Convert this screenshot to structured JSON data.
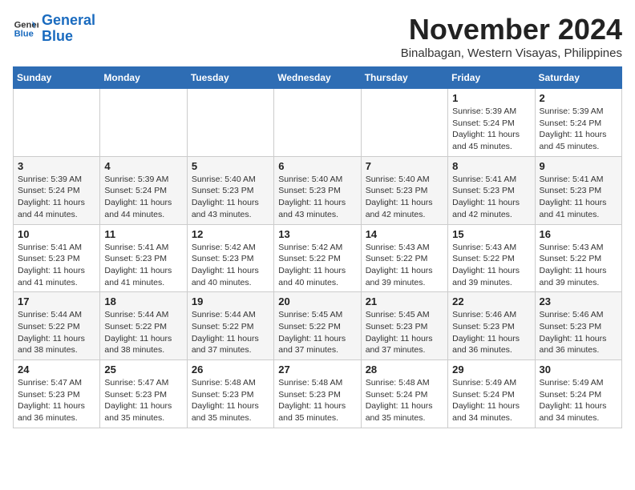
{
  "logo": {
    "text_general": "General",
    "text_blue": "Blue"
  },
  "header": {
    "month_year": "November 2024",
    "location": "Binalbagan, Western Visayas, Philippines"
  },
  "days_of_week": [
    "Sunday",
    "Monday",
    "Tuesday",
    "Wednesday",
    "Thursday",
    "Friday",
    "Saturday"
  ],
  "weeks": [
    [
      {
        "day": "",
        "info": ""
      },
      {
        "day": "",
        "info": ""
      },
      {
        "day": "",
        "info": ""
      },
      {
        "day": "",
        "info": ""
      },
      {
        "day": "",
        "info": ""
      },
      {
        "day": "1",
        "info": "Sunrise: 5:39 AM\nSunset: 5:24 PM\nDaylight: 11 hours and 45 minutes."
      },
      {
        "day": "2",
        "info": "Sunrise: 5:39 AM\nSunset: 5:24 PM\nDaylight: 11 hours and 45 minutes."
      }
    ],
    [
      {
        "day": "3",
        "info": "Sunrise: 5:39 AM\nSunset: 5:24 PM\nDaylight: 11 hours and 44 minutes."
      },
      {
        "day": "4",
        "info": "Sunrise: 5:39 AM\nSunset: 5:24 PM\nDaylight: 11 hours and 44 minutes."
      },
      {
        "day": "5",
        "info": "Sunrise: 5:40 AM\nSunset: 5:23 PM\nDaylight: 11 hours and 43 minutes."
      },
      {
        "day": "6",
        "info": "Sunrise: 5:40 AM\nSunset: 5:23 PM\nDaylight: 11 hours and 43 minutes."
      },
      {
        "day": "7",
        "info": "Sunrise: 5:40 AM\nSunset: 5:23 PM\nDaylight: 11 hours and 42 minutes."
      },
      {
        "day": "8",
        "info": "Sunrise: 5:41 AM\nSunset: 5:23 PM\nDaylight: 11 hours and 42 minutes."
      },
      {
        "day": "9",
        "info": "Sunrise: 5:41 AM\nSunset: 5:23 PM\nDaylight: 11 hours and 41 minutes."
      }
    ],
    [
      {
        "day": "10",
        "info": "Sunrise: 5:41 AM\nSunset: 5:23 PM\nDaylight: 11 hours and 41 minutes."
      },
      {
        "day": "11",
        "info": "Sunrise: 5:41 AM\nSunset: 5:23 PM\nDaylight: 11 hours and 41 minutes."
      },
      {
        "day": "12",
        "info": "Sunrise: 5:42 AM\nSunset: 5:23 PM\nDaylight: 11 hours and 40 minutes."
      },
      {
        "day": "13",
        "info": "Sunrise: 5:42 AM\nSunset: 5:22 PM\nDaylight: 11 hours and 40 minutes."
      },
      {
        "day": "14",
        "info": "Sunrise: 5:43 AM\nSunset: 5:22 PM\nDaylight: 11 hours and 39 minutes."
      },
      {
        "day": "15",
        "info": "Sunrise: 5:43 AM\nSunset: 5:22 PM\nDaylight: 11 hours and 39 minutes."
      },
      {
        "day": "16",
        "info": "Sunrise: 5:43 AM\nSunset: 5:22 PM\nDaylight: 11 hours and 39 minutes."
      }
    ],
    [
      {
        "day": "17",
        "info": "Sunrise: 5:44 AM\nSunset: 5:22 PM\nDaylight: 11 hours and 38 minutes."
      },
      {
        "day": "18",
        "info": "Sunrise: 5:44 AM\nSunset: 5:22 PM\nDaylight: 11 hours and 38 minutes."
      },
      {
        "day": "19",
        "info": "Sunrise: 5:44 AM\nSunset: 5:22 PM\nDaylight: 11 hours and 37 minutes."
      },
      {
        "day": "20",
        "info": "Sunrise: 5:45 AM\nSunset: 5:22 PM\nDaylight: 11 hours and 37 minutes."
      },
      {
        "day": "21",
        "info": "Sunrise: 5:45 AM\nSunset: 5:23 PM\nDaylight: 11 hours and 37 minutes."
      },
      {
        "day": "22",
        "info": "Sunrise: 5:46 AM\nSunset: 5:23 PM\nDaylight: 11 hours and 36 minutes."
      },
      {
        "day": "23",
        "info": "Sunrise: 5:46 AM\nSunset: 5:23 PM\nDaylight: 11 hours and 36 minutes."
      }
    ],
    [
      {
        "day": "24",
        "info": "Sunrise: 5:47 AM\nSunset: 5:23 PM\nDaylight: 11 hours and 36 minutes."
      },
      {
        "day": "25",
        "info": "Sunrise: 5:47 AM\nSunset: 5:23 PM\nDaylight: 11 hours and 35 minutes."
      },
      {
        "day": "26",
        "info": "Sunrise: 5:48 AM\nSunset: 5:23 PM\nDaylight: 11 hours and 35 minutes."
      },
      {
        "day": "27",
        "info": "Sunrise: 5:48 AM\nSunset: 5:23 PM\nDaylight: 11 hours and 35 minutes."
      },
      {
        "day": "28",
        "info": "Sunrise: 5:48 AM\nSunset: 5:24 PM\nDaylight: 11 hours and 35 minutes."
      },
      {
        "day": "29",
        "info": "Sunrise: 5:49 AM\nSunset: 5:24 PM\nDaylight: 11 hours and 34 minutes."
      },
      {
        "day": "30",
        "info": "Sunrise: 5:49 AM\nSunset: 5:24 PM\nDaylight: 11 hours and 34 minutes."
      }
    ]
  ]
}
